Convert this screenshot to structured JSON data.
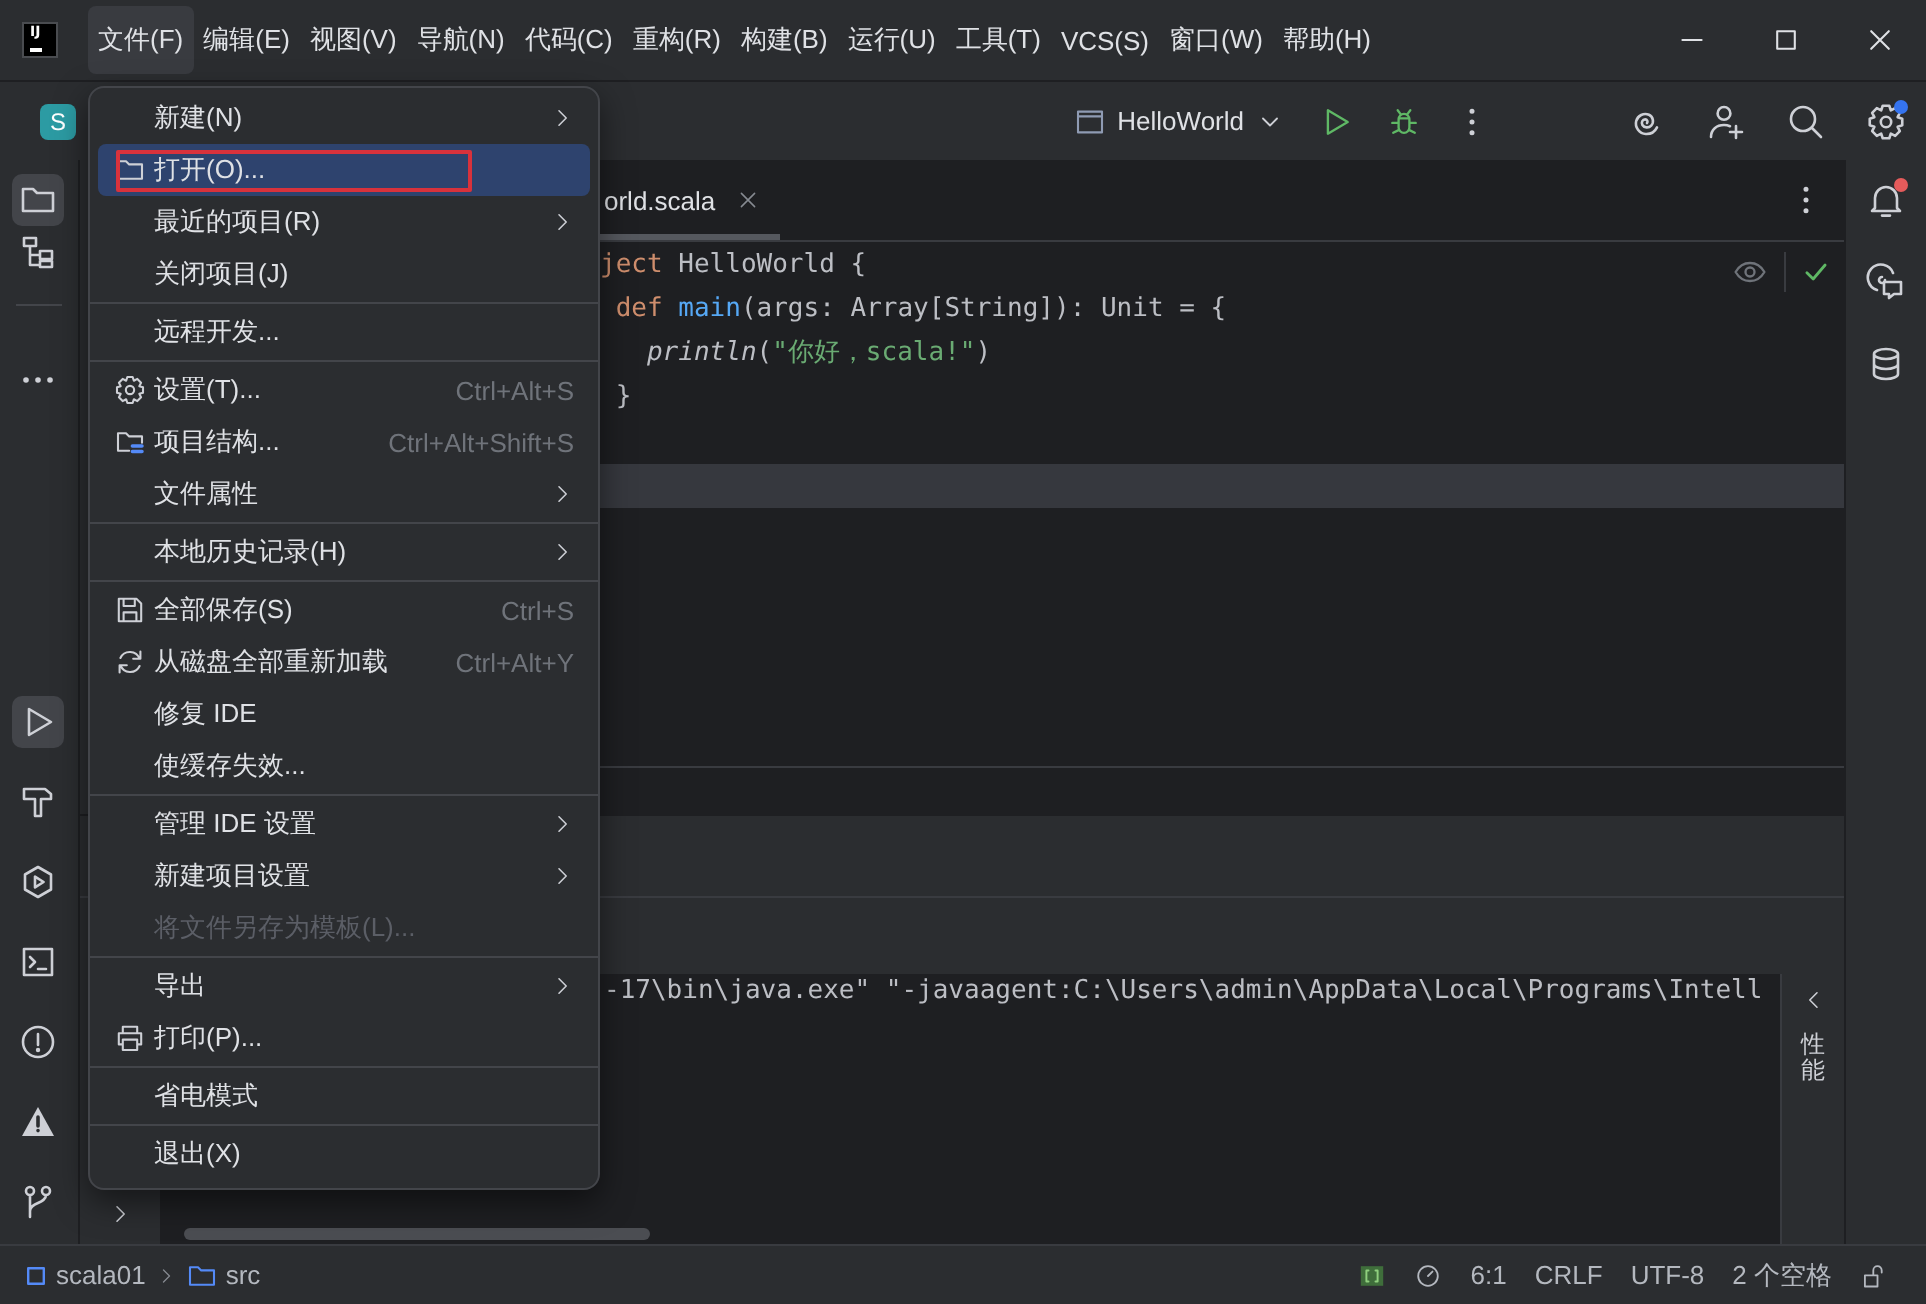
{
  "window": {
    "logo": "IJ",
    "menu_bar": [
      {
        "label": "文件(F)",
        "selected": true
      },
      {
        "label": "编辑(E)",
        "selected": false
      },
      {
        "label": "视图(V)",
        "selected": false
      },
      {
        "label": "导航(N)",
        "selected": false
      },
      {
        "label": "代码(C)",
        "selected": false
      },
      {
        "label": "重构(R)",
        "selected": false
      },
      {
        "label": "构建(B)",
        "selected": false
      },
      {
        "label": "运行(U)",
        "selected": false
      },
      {
        "label": "工具(T)",
        "selected": false
      },
      {
        "label": "VCS(S)",
        "selected": false
      },
      {
        "label": "窗口(W)",
        "selected": false
      },
      {
        "label": "帮助(H)",
        "selected": false
      }
    ]
  },
  "toolbar": {
    "project_badge": "S",
    "run_configuration": "HelloWorld"
  },
  "tool_strip": {
    "top": [
      {
        "selected": true
      },
      {
        "selected": false
      }
    ],
    "bottom": [
      {
        "selected": true
      },
      {
        "selected": false
      },
      {
        "selected": false
      },
      {
        "selected": false
      },
      {
        "selected": false
      },
      {
        "selected": false
      },
      {
        "selected": false
      }
    ]
  },
  "file_menu": {
    "sections": [
      {
        "items": [
          {
            "label": "新建(N)",
            "submenu": true,
            "disabled": false,
            "selected": false,
            "annotated": false
          },
          {
            "label": "打开(O)...",
            "submenu": false,
            "disabled": false,
            "selected": true,
            "annotated": true
          },
          {
            "label": "最近的项目(R)",
            "submenu": true,
            "disabled": false,
            "selected": false,
            "annotated": false
          },
          {
            "label": "关闭项目(J)",
            "submenu": false,
            "disabled": false,
            "selected": false,
            "annotated": false
          }
        ]
      },
      {
        "items": [
          {
            "label": "远程开发...",
            "submenu": false,
            "disabled": false,
            "selected": false,
            "annotated": false
          }
        ]
      },
      {
        "items": [
          {
            "label": "设置(T)...",
            "shortcut": "Ctrl+Alt+S",
            "submenu": false,
            "disabled": false,
            "selected": false,
            "annotated": false
          },
          {
            "label": "项目结构...",
            "shortcut": "Ctrl+Alt+Shift+S",
            "submenu": false,
            "disabled": false,
            "selected": false,
            "annotated": false
          },
          {
            "label": "文件属性",
            "submenu": true,
            "disabled": false,
            "selected": false,
            "annotated": false
          }
        ]
      },
      {
        "items": [
          {
            "label": "本地历史记录(H)",
            "submenu": true,
            "disabled": false,
            "selected": false,
            "annotated": false
          }
        ]
      },
      {
        "items": [
          {
            "label": "全部保存(S)",
            "shortcut": "Ctrl+S",
            "submenu": false,
            "disabled": false,
            "selected": false,
            "annotated": false
          },
          {
            "label": "从磁盘全部重新加载",
            "shortcut": "Ctrl+Alt+Y",
            "submenu": false,
            "disabled": false,
            "selected": false,
            "annotated": false
          },
          {
            "label": "修复 IDE",
            "submenu": false,
            "disabled": false,
            "selected": false,
            "annotated": false
          },
          {
            "label": "使缓存失效...",
            "submenu": false,
            "disabled": false,
            "selected": false,
            "annotated": false
          }
        ]
      },
      {
        "items": [
          {
            "label": "管理 IDE 设置",
            "submenu": true,
            "disabled": false,
            "selected": false,
            "annotated": false
          },
          {
            "label": "新建项目设置",
            "submenu": true,
            "disabled": false,
            "selected": false,
            "annotated": false
          },
          {
            "label": "将文件另存为模板(L)...",
            "submenu": false,
            "disabled": true,
            "selected": false,
            "annotated": false
          }
        ]
      },
      {
        "items": [
          {
            "label": "导出",
            "submenu": true,
            "disabled": false,
            "selected": false,
            "annotated": false
          },
          {
            "label": "打印(P)...",
            "submenu": false,
            "disabled": false,
            "selected": false,
            "annotated": false
          }
        ]
      },
      {
        "items": [
          {
            "label": "省电模式",
            "submenu": false,
            "disabled": false,
            "selected": false,
            "annotated": false
          }
        ]
      },
      {
        "items": [
          {
            "label": "退出(X)",
            "submenu": false,
            "disabled": false,
            "selected": false,
            "annotated": false
          }
        ]
      }
    ]
  },
  "editor": {
    "tab": {
      "label": "orld.scala",
      "selected": true
    },
    "lines": [
      {
        "tokens": [
          {
            "text": "ject",
            "kind": "keyword"
          },
          {
            "text": " HelloWorld {",
            "kind": "plain"
          }
        ],
        "current": false
      },
      {
        "tokens": [
          {
            "text": " def",
            "kind": "keyword"
          },
          {
            "text": " main",
            "kind": "function"
          },
          {
            "text": "(args: Array[String]): Unit = {",
            "kind": "plain"
          }
        ],
        "current": false
      },
      {
        "tokens": [
          {
            "text": "   println",
            "kind": "call"
          },
          {
            "text": "(",
            "kind": "plain"
          },
          {
            "text": "\"你好，scala!\"",
            "kind": "string"
          },
          {
            "text": ")",
            "kind": "plain"
          }
        ],
        "current": false
      },
      {
        "tokens": [
          {
            "text": " }",
            "kind": "plain"
          }
        ],
        "current": false
      },
      {
        "current": false
      },
      {
        "current": true
      }
    ]
  },
  "run_panel": {
    "console_line": "-17\\bin\\java.exe\" \"-javaagent:C:\\Users\\admin\\AppData\\Local\\Programs\\Intell",
    "side_label": "性能"
  },
  "status_bar": {
    "breadcrumbs": [
      "scala01",
      "src"
    ],
    "items": [
      "6:1",
      "CRLF",
      "UTF-8",
      "2 个空格"
    ]
  }
}
